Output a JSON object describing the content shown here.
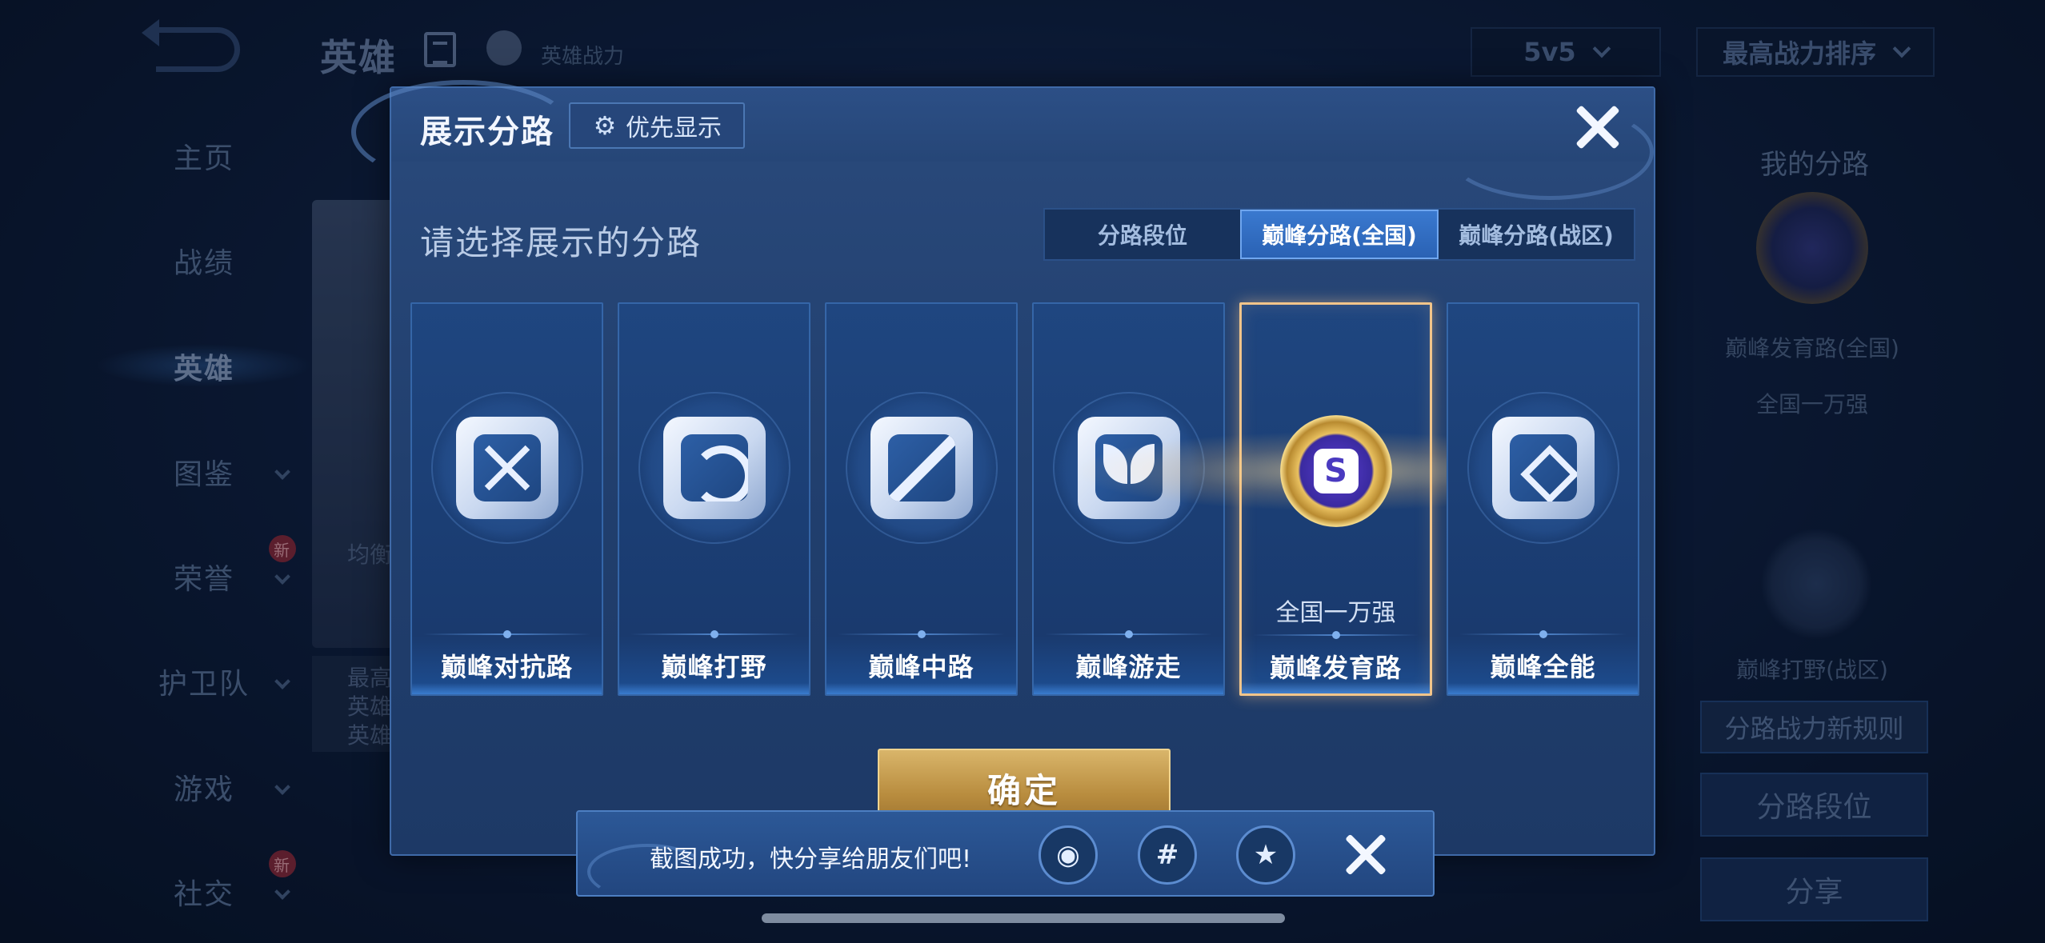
{
  "background": {
    "title": "英雄",
    "subtitle": "英雄战力",
    "mode_select": "5v5",
    "sort_select": "最高战力排序",
    "sidebar": [
      {
        "label": "主页",
        "has_arrow": false,
        "new": false
      },
      {
        "label": "战绩",
        "has_arrow": false,
        "new": false
      },
      {
        "label": "英雄",
        "has_arrow": false,
        "new": false,
        "active": true
      },
      {
        "label": "图鉴",
        "has_arrow": true,
        "new": false
      },
      {
        "label": "荣誉",
        "has_arrow": true,
        "new": true
      },
      {
        "label": "护卫队",
        "has_arrow": true,
        "new": false
      },
      {
        "label": "游戏",
        "has_arrow": true,
        "new": false
      },
      {
        "label": "社交",
        "has_arrow": true,
        "new": true
      }
    ],
    "new_badge": "新",
    "left_card_texts": [
      "均衡发",
      "最高",
      "英雄",
      "英雄"
    ],
    "right_panel": {
      "title": "我的分路",
      "lane1": "巅峰发育路(全国)",
      "lane1_rank": "全国一万强",
      "lane2": "巅峰打野(战区)",
      "rules_button": "分路战力新规则",
      "rank_button": "分路段位",
      "share_button": "分享"
    }
  },
  "modal": {
    "title": "展示分路",
    "priority_button": "优先显示",
    "prompt": "请选择展示的分路",
    "tabs": [
      {
        "label": "分路段位",
        "active": false
      },
      {
        "label": "巅峰分路(全国)",
        "active": true
      },
      {
        "label": "巅峰分路(战区)",
        "active": false
      }
    ],
    "lanes": [
      {
        "name": "巅峰对抗路",
        "icon": "cross-swords-icon",
        "rank": "",
        "selected": false
      },
      {
        "name": "巅峰打野",
        "icon": "dragon-icon",
        "rank": "",
        "selected": false
      },
      {
        "name": "巅峰中路",
        "icon": "slash-icon",
        "rank": "",
        "selected": false
      },
      {
        "name": "巅峰游走",
        "icon": "wings-icon",
        "rank": "",
        "selected": false
      },
      {
        "name": "巅峰发育路",
        "icon": "gold-emblem-icon",
        "rank": "全国一万强",
        "selected": true
      },
      {
        "name": "巅峰全能",
        "icon": "diamond-icon",
        "rank": "",
        "selected": false
      }
    ],
    "emblem_letter": "S",
    "confirm_button": "确定"
  },
  "toast": {
    "message": "截图成功，快分享给朋友们吧!",
    "share_targets": [
      {
        "icon": "qq-icon",
        "glyph": "◉"
      },
      {
        "icon": "moments-icon",
        "glyph": "#"
      },
      {
        "icon": "qzone-icon",
        "glyph": "★"
      }
    ]
  },
  "colors": {
    "accent_blue": "#2a62b4",
    "gold": "#d9b56a",
    "selected_border": "#f2c58a"
  }
}
